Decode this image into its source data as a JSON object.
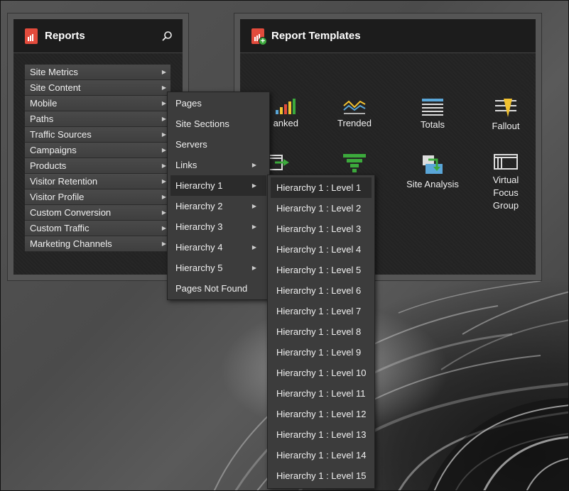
{
  "reports_panel": {
    "title": "Reports",
    "icon": "reports-icon",
    "search_icon": "search-icon",
    "items": [
      {
        "label": "Site Metrics"
      },
      {
        "label": "Site Content"
      },
      {
        "label": "Mobile"
      },
      {
        "label": "Paths"
      },
      {
        "label": "Traffic Sources"
      },
      {
        "label": "Campaigns"
      },
      {
        "label": "Products"
      },
      {
        "label": "Visitor Retention"
      },
      {
        "label": "Visitor Profile"
      },
      {
        "label": "Custom Conversion"
      },
      {
        "label": "Custom Traffic"
      },
      {
        "label": "Marketing Channels"
      }
    ]
  },
  "templates_panel": {
    "title": "Report Templates",
    "icon": "report-templates-icon",
    "items": [
      {
        "label": "Ranked",
        "visible_label": "anked",
        "icon": "ranked-icon"
      },
      {
        "label": "Trended",
        "icon": "trended-icon"
      },
      {
        "label": "Totals",
        "icon": "totals-icon"
      },
      {
        "label": "Fallout",
        "icon": "fallout-icon"
      },
      {
        "label": "",
        "icon": "pathing-icon"
      },
      {
        "label": "",
        "icon": "funnel-icon"
      },
      {
        "label": "Site Analysis",
        "icon": "site-analysis-icon"
      },
      {
        "label": "Virtual Focus Group",
        "line1": "Virtual",
        "line2": "Focus",
        "line3": "Group",
        "icon": "virtual-focus-group-icon"
      }
    ]
  },
  "site_content_menu": {
    "items": [
      {
        "label": "Pages",
        "has_submenu": false
      },
      {
        "label": "Site Sections",
        "has_submenu": false
      },
      {
        "label": "Servers",
        "has_submenu": false
      },
      {
        "label": "Links",
        "has_submenu": true
      },
      {
        "label": "Hierarchy 1",
        "has_submenu": true,
        "active": true
      },
      {
        "label": "Hierarchy 2",
        "has_submenu": true
      },
      {
        "label": "Hierarchy 3",
        "has_submenu": true
      },
      {
        "label": "Hierarchy 4",
        "has_submenu": true
      },
      {
        "label": "Hierarchy 5",
        "has_submenu": true
      },
      {
        "label": "Pages Not Found",
        "has_submenu": false
      }
    ]
  },
  "hierarchy_menu": {
    "items": [
      {
        "label": "Hierarchy 1 : Level 1"
      },
      {
        "label": "Hierarchy 1 : Level 2"
      },
      {
        "label": "Hierarchy 1 : Level 3"
      },
      {
        "label": "Hierarchy 1 : Level 4"
      },
      {
        "label": "Hierarchy 1 : Level 5"
      },
      {
        "label": "Hierarchy 1 : Level 6"
      },
      {
        "label": "Hierarchy 1 : Level 7"
      },
      {
        "label": "Hierarchy 1 : Level 8"
      },
      {
        "label": "Hierarchy 1 : Level 9"
      },
      {
        "label": "Hierarchy 1 : Level 10"
      },
      {
        "label": "Hierarchy 1 : Level 11"
      },
      {
        "label": "Hierarchy 1 : Level 12"
      },
      {
        "label": "Hierarchy 1 : Level 13"
      },
      {
        "label": "Hierarchy 1 : Level 14"
      },
      {
        "label": "Hierarchy 1 : Level 15"
      }
    ]
  },
  "colors": {
    "accent_red": "#e34b3c",
    "accent_green": "#3caa3c",
    "accent_yellow": "#f2c230",
    "accent_blue": "#5aa6d8"
  }
}
